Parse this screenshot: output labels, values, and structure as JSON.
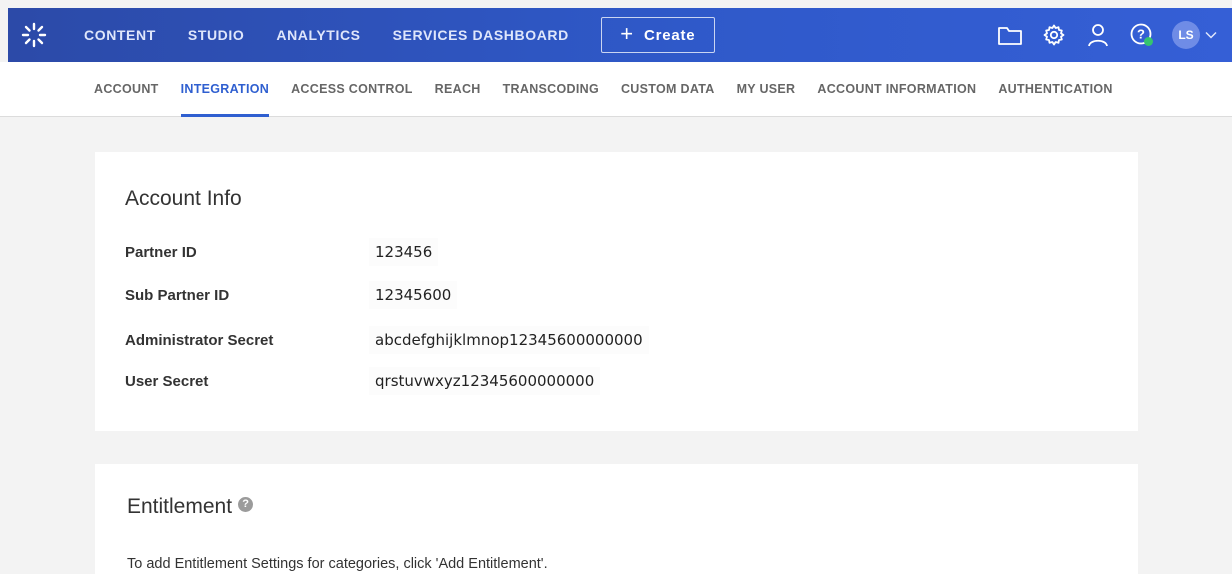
{
  "topnav": {
    "items": [
      "CONTENT",
      "STUDIO",
      "ANALYTICS",
      "SERVICES DASHBOARD"
    ],
    "create_label": "Create",
    "avatar_initials": "LS",
    "icons": [
      "kaltura-logo-icon",
      "folder-icon",
      "gear-icon",
      "user-icon",
      "help-icon",
      "chevron-down-icon"
    ],
    "status_color": "#35c46f"
  },
  "subnav": {
    "items": [
      "ACCOUNT",
      "INTEGRATION",
      "ACCESS CONTROL",
      "REACH",
      "TRANSCODING",
      "CUSTOM DATA",
      "MY USER",
      "ACCOUNT INFORMATION",
      "AUTHENTICATION"
    ],
    "active": "INTEGRATION"
  },
  "account_info": {
    "title": "Account Info",
    "rows": [
      {
        "label": "Partner ID",
        "value": "123456"
      },
      {
        "label": "Sub Partner ID",
        "value": "12345600"
      },
      {
        "label": "Administrator Secret",
        "value": "abcdefghijklmnop12345600000000"
      },
      {
        "label": "User Secret",
        "value": "qrstuvwxyz12345600000000"
      }
    ]
  },
  "entitlement": {
    "title": "Entitlement",
    "help_glyph": "?",
    "description": "To add Entitlement Settings for categories, click 'Add Entitlement'."
  },
  "colors": {
    "topbar": "#2f59c9",
    "accent": "#2f5fd0",
    "background": "#f3f3f3"
  }
}
